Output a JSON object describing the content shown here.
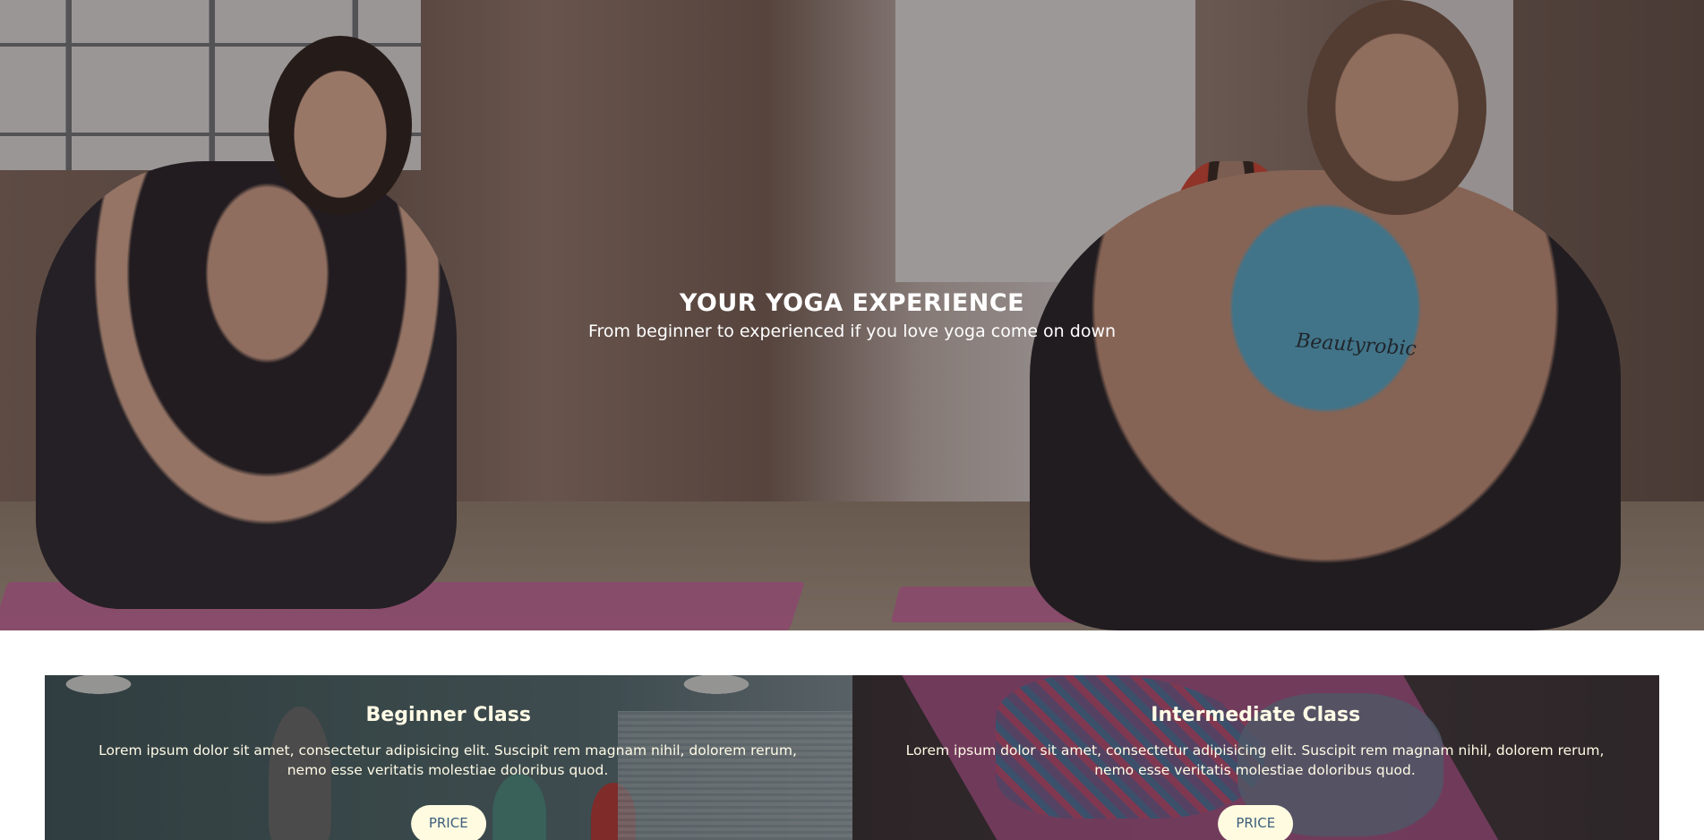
{
  "hero": {
    "title": "YOUR YOGA EXPERIENCE",
    "subtitle": "From beginner to experienced if you love yoga come on down",
    "top_brand_print": "Beautyrobic"
  },
  "classes": [
    {
      "title": "Beginner Class",
      "description": "Lorem ipsum dolor sit amet, consectetur adipisicing elit. Suscipit rem magnam nihil, dolorem rerum, nemo esse veritatis molestiae doloribus quod.",
      "button_label": "PRICE"
    },
    {
      "title": "Intermediate Class",
      "description": "Lorem ipsum dolor sit amet, consectetur adipisicing elit. Suscipit rem magnam nihil, dolorem rerum, nemo esse veritatis molestiae doloribus quod.",
      "button_label": "PRICE"
    }
  ],
  "colors": {
    "card_text": "#fffbe6",
    "button_bg": "#fffbe0",
    "button_text": "#3d5f7c"
  }
}
